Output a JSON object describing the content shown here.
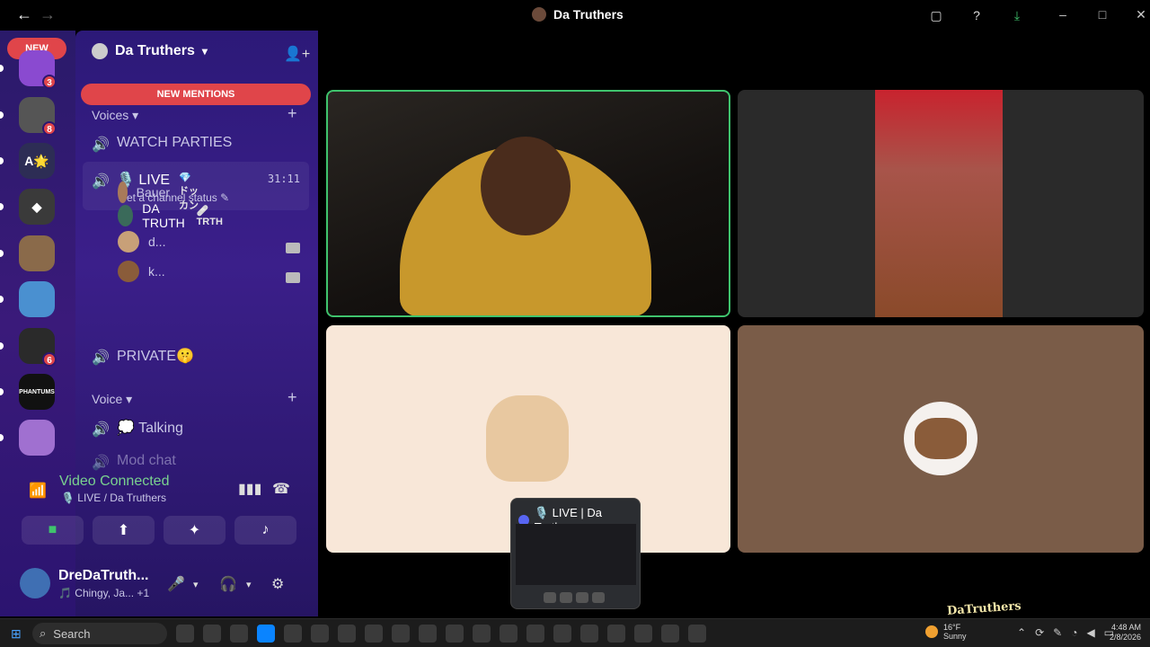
{
  "window": {
    "title": "Da Truthers"
  },
  "rail": {
    "new_label": "NEW",
    "servers": [
      {
        "badge": "3",
        "color": "#8a4ad0"
      },
      {
        "badge": "8",
        "color": "#555555"
      },
      {
        "badge": "",
        "color": "#2d2d55",
        "text": "A🌟"
      },
      {
        "badge": "",
        "color": "#3a3a3a",
        "text": "◆"
      },
      {
        "badge": "",
        "color": "#8a6a4a"
      },
      {
        "badge": "",
        "color": "#4a90d0"
      },
      {
        "badge": "6",
        "color": "#2a2a2a"
      },
      {
        "badge": "",
        "color": "#111111",
        "text": "PHANTUMS"
      },
      {
        "badge": "",
        "color": "#a070d0"
      }
    ]
  },
  "sidebar": {
    "server_name": "Da Truthers",
    "new_mentions": "NEW MENTIONS",
    "cat_voices": "Voices",
    "watch_parties": "WATCH PARTIES",
    "live_channel": "🎙️ LIVE",
    "live_timer": "31:11",
    "live_status": "Set a channel status",
    "members": [
      {
        "name": "Bauer",
        "tag": "💎 ドッカン",
        "cam": false
      },
      {
        "name": "DA TRUTH",
        "tag": "🩹 TRTH",
        "cam": true
      },
      {
        "name": "d...",
        "tag": "",
        "cam": true
      },
      {
        "name": "k...",
        "tag": "",
        "cam": false
      }
    ],
    "private": "PRIVATE🤫",
    "cat_voice": "Voice",
    "talking": "💭 Talking",
    "mod_chat": "Mod chat"
  },
  "voice_panel": {
    "status": "Video Connected",
    "channel": "🎙️ LIVE / Da Truthers"
  },
  "user_panel": {
    "name": "DreDaTruth...",
    "activity": "🎵 Chingy, Ja...",
    "activity_extra": "+1"
  },
  "popup": {
    "title": "🎙️ LIVE | Da Truth..."
  },
  "taskbar": {
    "search": "Search",
    "weather_temp": "16°F",
    "weather_desc": "Sunny",
    "weather_badge": "2",
    "time": "4:48 AM",
    "date": "2/8/2026"
  },
  "watermark": "DaTruthers"
}
